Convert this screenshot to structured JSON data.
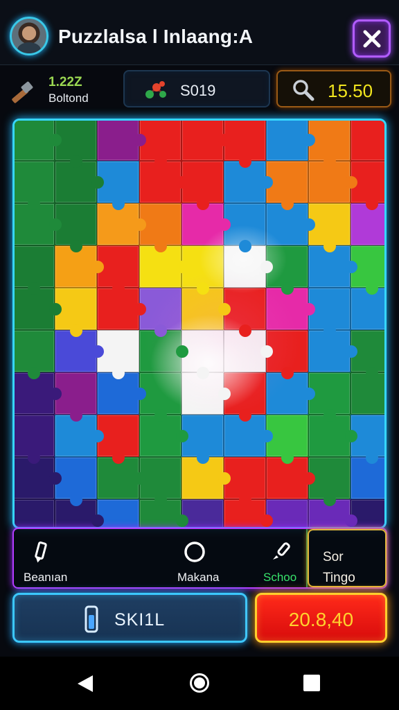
{
  "header": {
    "title": "Puzzlalsa l Inlaang:A",
    "avatar_icon": "player-avatar",
    "close_icon": "close-x"
  },
  "stats": {
    "left_value": "1.22Z",
    "left_label": "Boltond",
    "left_icon": "hammer-tool",
    "mid_value": "S019",
    "mid_icon": "molecule-pieces",
    "right_value": "15.50",
    "right_icon": "magnifier"
  },
  "board": {
    "rows": 10,
    "cols": 9,
    "tiles": [
      [
        "#1f8a3a",
        "#1b7d34",
        "#8a1e8c",
        "#e8201e",
        "#e8201e",
        "#e8201e",
        "#1e8ad8",
        "#f07a16",
        "#e8201e"
      ],
      [
        "#1f8a3a",
        "#1b7d34",
        "#1e8ad8",
        "#e8201e",
        "#e8201e",
        "#1e8ad8",
        "#f07a16",
        "#f07a16",
        "#e8201e"
      ],
      [
        "#1f8a3a",
        "#1b7d34",
        "#f59a1a",
        "#f07a16",
        "#e62aa8",
        "#1e8ad8",
        "#1e8ad8",
        "#f5c915",
        "#b03ad8"
      ],
      [
        "#1b7d34",
        "#f5a015",
        "#e8201e",
        "#f5e012",
        "#f5e012",
        "#f4f4f4",
        "#1f9a40",
        "#1e8ad8",
        "#38c640"
      ],
      [
        "#1b7d34",
        "#f5c915",
        "#e8201e",
        "#8a5ad8",
        "#f5c915",
        "#e8201e",
        "#e62aa8",
        "#1e8ad8",
        "#1e8ad8"
      ],
      [
        "#1f8a3a",
        "#4a4ad8",
        "#f4f4f4",
        "#1f9a40",
        "#f4f4f4",
        "#f4f4f4",
        "#e8201e",
        "#1e8ad8",
        "#1f8a3a"
      ],
      [
        "#3a1a7a",
        "#8a1e8c",
        "#1e6ad8",
        "#1f9a40",
        "#f4f4f4",
        "#e8201e",
        "#1e8ad8",
        "#1f9a40",
        "#1f8a3a"
      ],
      [
        "#3a1a7a",
        "#1e8ad8",
        "#e8201e",
        "#1f9a40",
        "#1e8ad8",
        "#1e8ad8",
        "#38c640",
        "#1f9a40",
        "#1e8ad8"
      ],
      [
        "#2a1a6a",
        "#1e6ad8",
        "#1f8a3a",
        "#1f8a3a",
        "#f5c915",
        "#e8201e",
        "#e8201e",
        "#1f8a3a",
        "#1e6ad8"
      ],
      [
        "#2a1a6a",
        "#2a1a6a",
        "#1e6ad8",
        "#1f8a3a",
        "#4a2a9a",
        "#e8201e",
        "#6a2ab8",
        "#6a2ab8",
        "#2a1a6a"
      ]
    ]
  },
  "tools": [
    {
      "label": "Beanıan",
      "icon": "pencil-tool"
    },
    {
      "label": "Makana",
      "icon": "ring-circle"
    },
    {
      "label": "Schoo",
      "icon": "brush-tool"
    }
  ],
  "side_panel": {
    "line1": "Sor",
    "line2": "Tingo"
  },
  "buttons": {
    "skill_label": "SKI1L",
    "skill_icon": "potion-vial",
    "score_label": "20.8,40"
  },
  "colors": {
    "cyan_glow": "#36d6ff",
    "purple_glow": "#b43cff",
    "score_red": "#e8201e",
    "score_text": "#ffd22e",
    "timer_yellow": "#f2e51e"
  },
  "nav": {
    "back_icon": "back-triangle",
    "home_icon": "home-circle",
    "recents_icon": "recents-square"
  }
}
